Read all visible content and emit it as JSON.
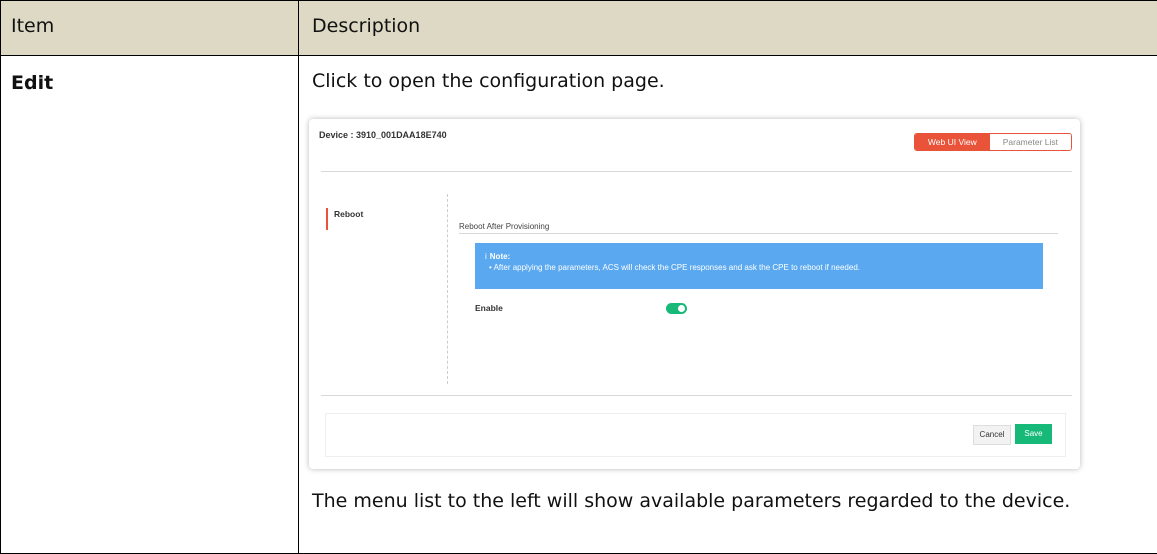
{
  "table": {
    "headers": [
      "Item",
      "Description"
    ],
    "row": {
      "item": "Edit",
      "intro": "Click to open the configuration page.",
      "outro": "The menu list to the left will show available parameters regarded to the device."
    }
  },
  "screenshot": {
    "device_title": "Device : 3910_001DAA18E740",
    "view_tabs": [
      "Web UI View",
      "Parameter List"
    ],
    "active_tab": "Web UI View",
    "menu": [
      "Reboot"
    ],
    "section_title": "Reboot After Provisioning",
    "note_title": "Note:",
    "note_icon": "i",
    "note_text": "• After applying the parameters, ACS will check the CPE responses and ask the CPE to reboot if needed.",
    "enable_label": "Enable",
    "enable_state": true,
    "cancel_label": "Cancel",
    "save_label": "Save",
    "colors": {
      "accent": "#e8533a",
      "note_bg": "#5aa8ef",
      "toggle_on": "#17b978",
      "save": "#17b978",
      "header_bg": "#ddd9c4"
    }
  }
}
